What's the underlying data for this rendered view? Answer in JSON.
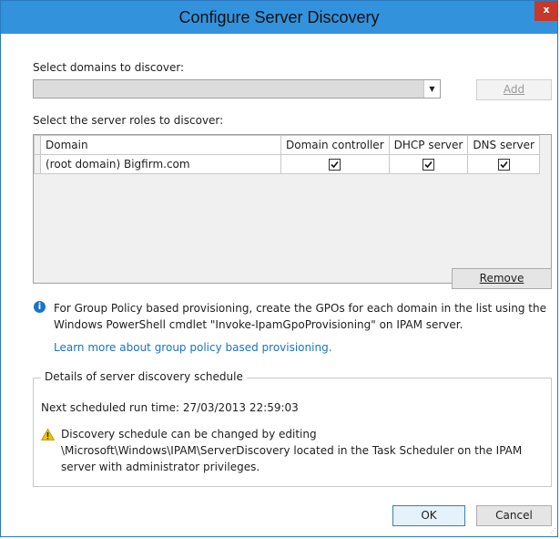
{
  "window": {
    "title": "Configure Server Discovery",
    "close_glyph": "x"
  },
  "domains": {
    "label": "Select domains to discover:",
    "selected_value": "",
    "add_label": "Add"
  },
  "roles": {
    "label": "Select the server roles to discover:",
    "columns": [
      "Domain",
      "Domain controller",
      "DHCP server",
      "DNS server"
    ],
    "rows": [
      {
        "domain": "(root domain) Bigfirm.com",
        "domain_controller": true,
        "dhcp_server": true,
        "dns_server": true
      }
    ],
    "remove_label": "Remove"
  },
  "info": {
    "text": "For Group Policy based provisioning, create the GPOs for each domain in the list using the Windows PowerShell cmdlet \"Invoke-IpamGpoProvisioning\" on IPAM server.",
    "link_text": "Learn more about group policy based provisioning."
  },
  "schedule": {
    "legend": "Details of server discovery schedule",
    "next_run": "Next scheduled run time: 27/03/2013 22:59:03",
    "warning": "Discovery schedule can be changed by editing \\Microsoft\\Windows\\IPAM\\ServerDiscovery located in the Task Scheduler on the IPAM server with administrator privileges."
  },
  "footer": {
    "ok_label": "OK",
    "cancel_label": "Cancel"
  },
  "colors": {
    "titlebar": "#3392dc",
    "close": "#c7382b",
    "link": "#1a73c8"
  }
}
